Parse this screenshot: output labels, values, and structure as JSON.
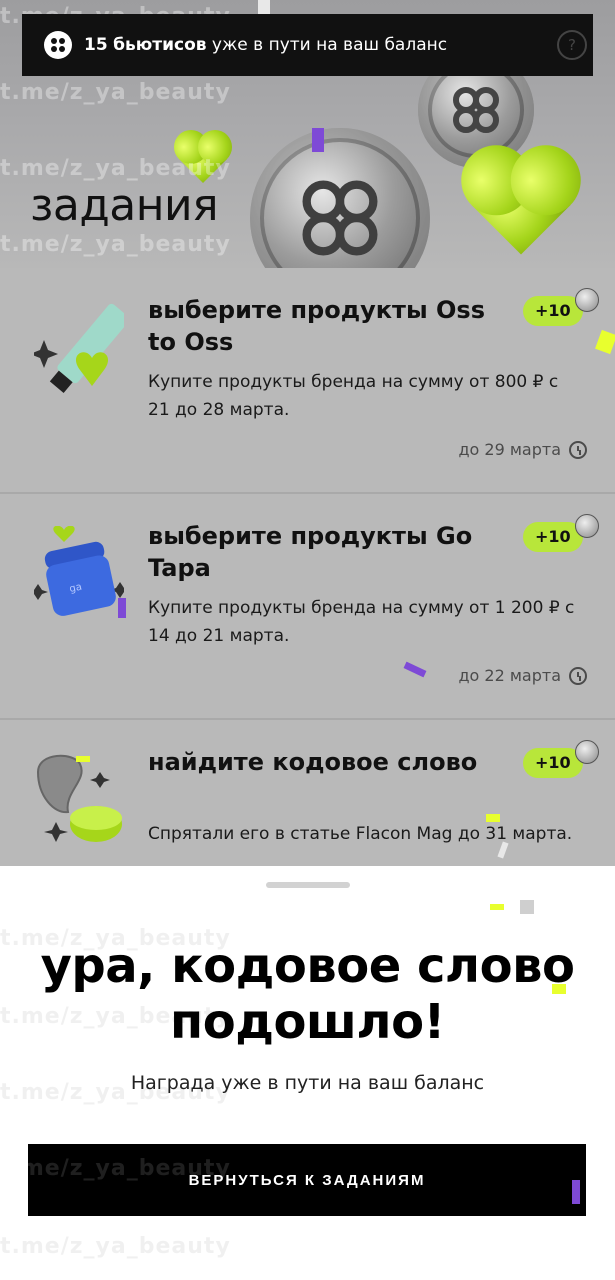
{
  "toast": {
    "count": "15",
    "strong": "бьютисов",
    "text": "уже в пути на ваш баланс",
    "help": "?"
  },
  "hero": {
    "title": "задания"
  },
  "tasks": [
    {
      "title": "выберите продукты Oss to Oss",
      "desc": "Купите продукты бренда на сумму от 800 ₽ с 21 до 28 марта.",
      "deadline": "до 29 марта",
      "reward": "+10",
      "image": "cream-tube-icon"
    },
    {
      "title": "выберите продукты Go Tapa",
      "desc": "Купите продукты бренда на сумму от 1 200 ₽ с 14 до 21 марта.",
      "deadline": "до 22 марта",
      "reward": "+10",
      "image": "blue-jar-icon"
    },
    {
      "title": "найдите кодовое слово",
      "desc": "Спрятали его в статье Flacon Mag до 31 марта.",
      "deadline": "",
      "reward": "+10",
      "image": "gua-sha-icon"
    }
  ],
  "sheet": {
    "title_line1": "ура, кодовое слово",
    "title_line2": "подошло!",
    "subtitle": "Награда уже в пути на ваш баланс",
    "button": "ВЕРНУТЬСЯ К ЗАДАНИЯМ"
  },
  "watermark": "t.me/z_ya_beauty",
  "colors": {
    "accent": "#b8e63a",
    "confetti_purple": "#7e4ad6",
    "confetti_lime": "#e8ff2e"
  }
}
